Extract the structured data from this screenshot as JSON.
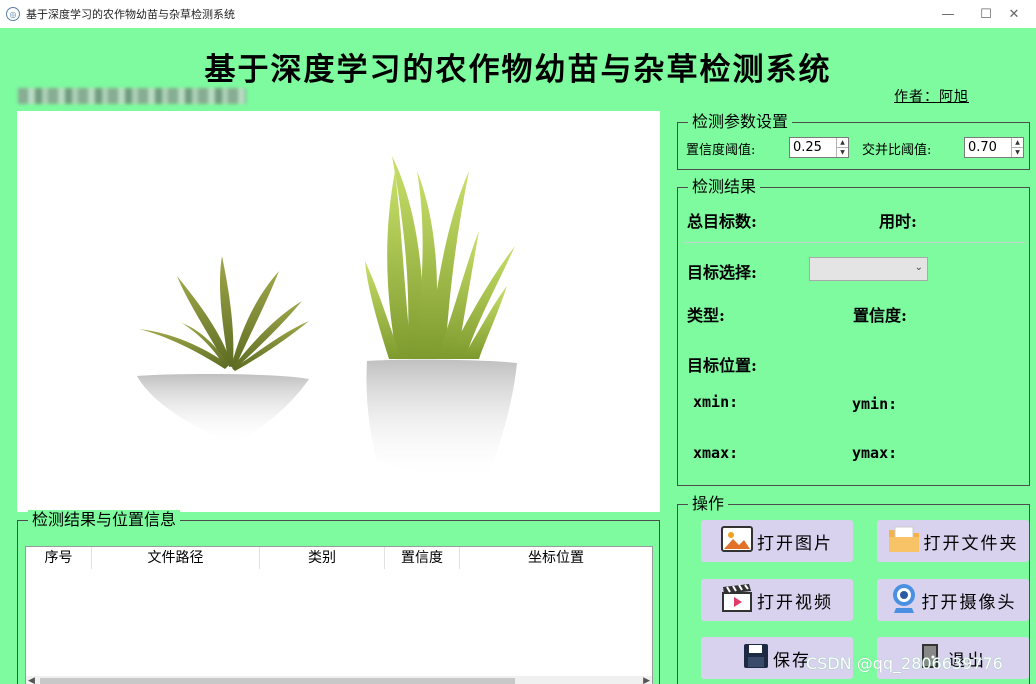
{
  "window": {
    "title": "基于深度学习的农作物幼苗与杂草检测系统",
    "controls": [
      "—",
      "☐",
      "✕"
    ]
  },
  "header": {
    "main_title": "基于深度学习的农作物幼苗与杂草检测系统",
    "author": "作者：阿旭"
  },
  "params": {
    "group_title": "检测参数设置",
    "confidence_label": "置信度阈值:",
    "confidence_value": "0.25",
    "iou_label": "交并比阈值:",
    "iou_value": "0.70"
  },
  "results": {
    "group_title": "检测结果",
    "total_label": "总目标数:",
    "time_label": "用时:",
    "target_select_label": "目标选择:",
    "type_label": "类型:",
    "confidence_label": "置信度:",
    "position_label": "目标位置:",
    "xmin_label": "xmin:",
    "ymin_label": "ymin:",
    "xmax_label": "xmax:",
    "ymax_label": "ymax:"
  },
  "table": {
    "group_title": "检测结果与位置信息",
    "columns": [
      "序号",
      "文件路径",
      "类别",
      "置信度",
      "坐标位置"
    ]
  },
  "ops": {
    "group_title": "操作",
    "open_image": "打开图片",
    "open_folder": "打开文件夹",
    "open_video": "打开视频",
    "open_camera": "打开摄像头",
    "save": "保存",
    "exit": "退出"
  },
  "watermark": "CSDN @qq_2806639776",
  "colors": {
    "background": "#7dfb9e",
    "button": "#d9d2ee"
  }
}
